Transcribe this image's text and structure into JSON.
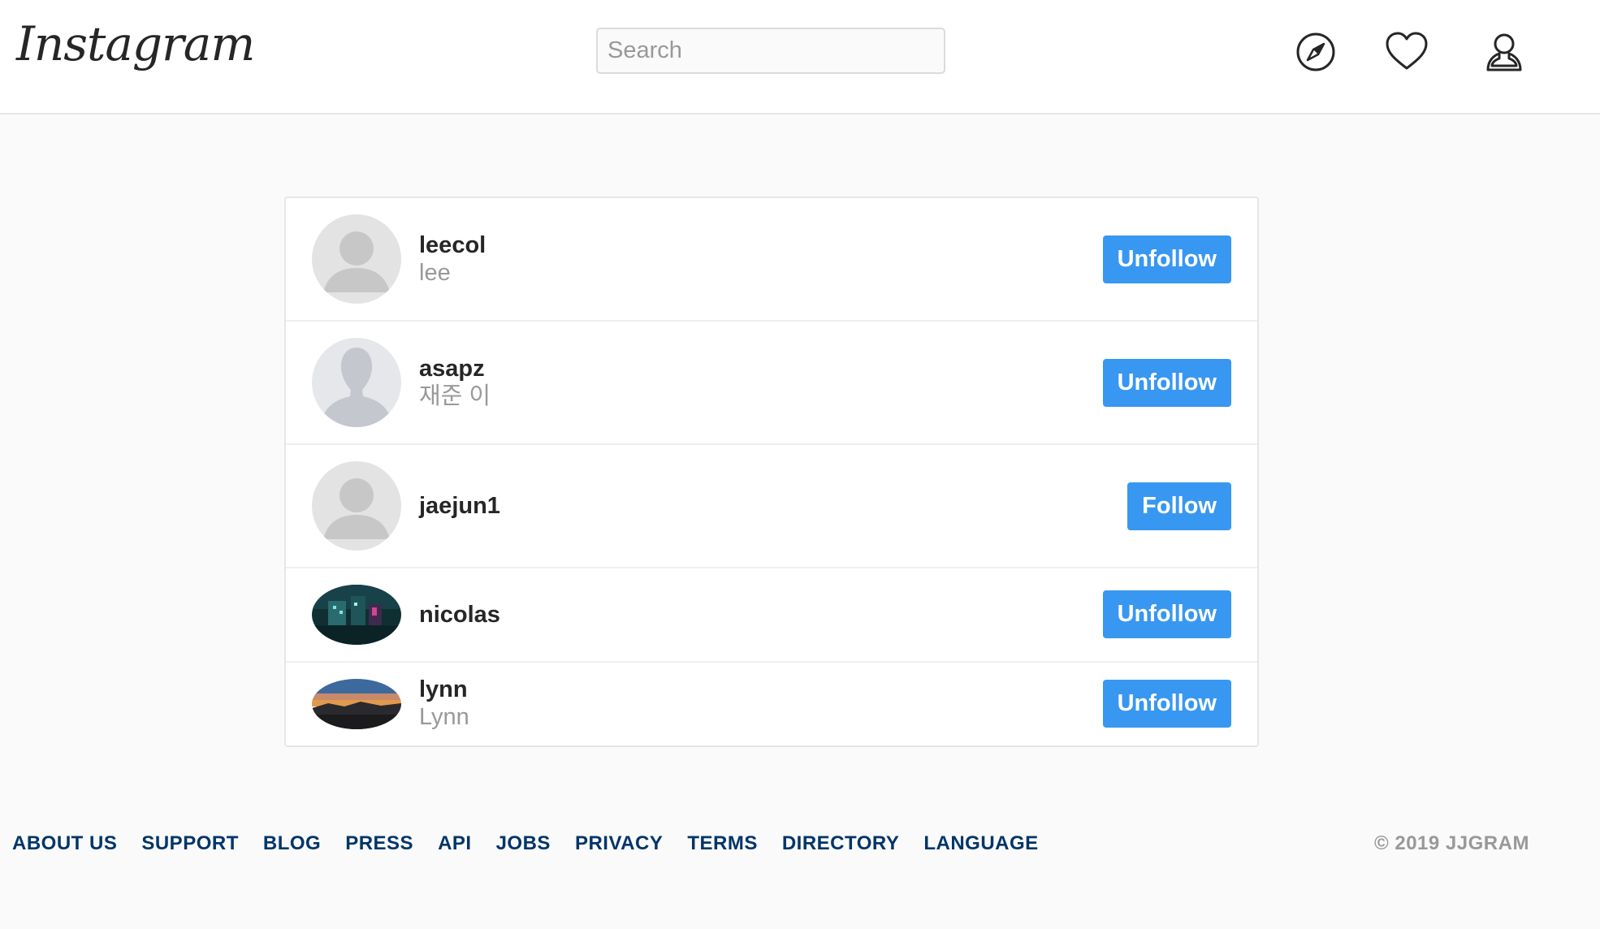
{
  "header": {
    "logo": "Instagram",
    "search": {
      "placeholder": "Search",
      "value": ""
    },
    "icons": [
      "compass-icon",
      "heart-icon",
      "profile-icon"
    ]
  },
  "users": [
    {
      "username": "leecol",
      "fullname": "lee",
      "action": "Unfollow",
      "avatar": "default-avatar"
    },
    {
      "username": "asapz",
      "fullname": "재준 이",
      "action": "Unfollow",
      "avatar": "silhouette-avatar"
    },
    {
      "username": "jaejun1",
      "fullname": "",
      "action": "Follow",
      "avatar": "default-avatar"
    },
    {
      "username": "nicolas",
      "fullname": "",
      "action": "Unfollow",
      "avatar": "city-night-photo"
    },
    {
      "username": "lynn",
      "fullname": "Lynn",
      "action": "Unfollow",
      "avatar": "sunset-city-photo"
    }
  ],
  "footer": {
    "links": [
      "ABOUT US",
      "SUPPORT",
      "BLOG",
      "PRESS",
      "API",
      "JOBS",
      "PRIVACY",
      "TERMS",
      "DIRECTORY",
      "LANGUAGE"
    ],
    "copyright": "© 2019 JJGRAM"
  },
  "colors": {
    "button": "#3897f0",
    "footer_link": "#003569",
    "muted": "#999999",
    "background": "#fafafa"
  }
}
